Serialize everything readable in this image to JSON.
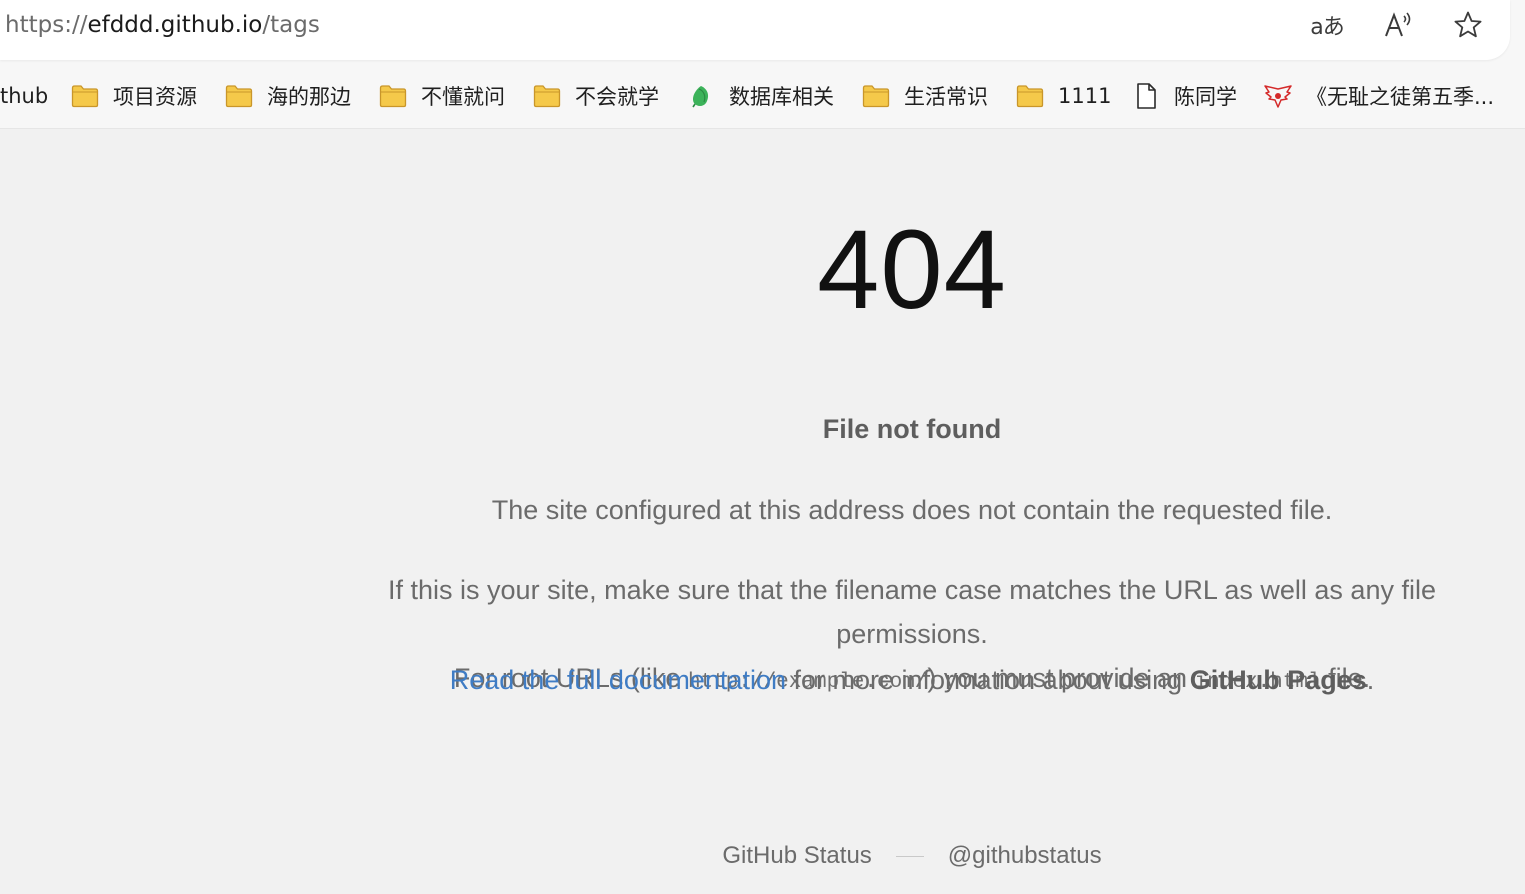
{
  "browser": {
    "url": {
      "scheme": "https://",
      "host": "efddd.github.io",
      "path": "/tags"
    },
    "toolbar": {
      "translate_icon": "translate-icon",
      "read_aloud_icon": "read-aloud-icon",
      "favorite_icon": "star-icon",
      "translate_glyph": "aあ"
    },
    "bookmarks": [
      {
        "label": "thub",
        "icon": "none"
      },
      {
        "label": "项目资源",
        "icon": "folder-icon"
      },
      {
        "label": "海的那边",
        "icon": "folder-icon"
      },
      {
        "label": "不懂就问",
        "icon": "folder-icon"
      },
      {
        "label": "不会就学",
        "icon": "folder-icon"
      },
      {
        "label": "数据库相关",
        "icon": "leaf-icon"
      },
      {
        "label": "生活常识",
        "icon": "folder-icon"
      },
      {
        "label": "1111",
        "icon": "folder-icon"
      },
      {
        "label": "陈同学",
        "icon": "page-icon"
      },
      {
        "label": "《无耻之徒第五季...",
        "icon": "wings-logo-icon"
      }
    ]
  },
  "page": {
    "code": "404",
    "headline": "File not found",
    "paragraph1": "The site configured at this address does not contain the requested file.",
    "paragraph2": "If this is your site, make sure that the filename case matches the URL as well as any file permissions.",
    "paragraph2b_prefix": "For root URLs (like ",
    "paragraph2b_code1": "http://example.com/",
    "paragraph2b_middle": ") you must provide an ",
    "paragraph2b_code2": "index.html",
    "paragraph2b_suffix": " file.",
    "doc_link": "Read the full documentation",
    "doc_middle": " for more information about using ",
    "doc_strong": "GitHub Pages",
    "doc_end": "."
  },
  "footer": {
    "status_link": "GitHub Status",
    "twitter_link": "@githubstatus"
  },
  "colors": {
    "folder": "#f5c94a",
    "folder_stroke": "#c9962a",
    "link": "#3f7cc4",
    "background": "#f1f1f1"
  }
}
